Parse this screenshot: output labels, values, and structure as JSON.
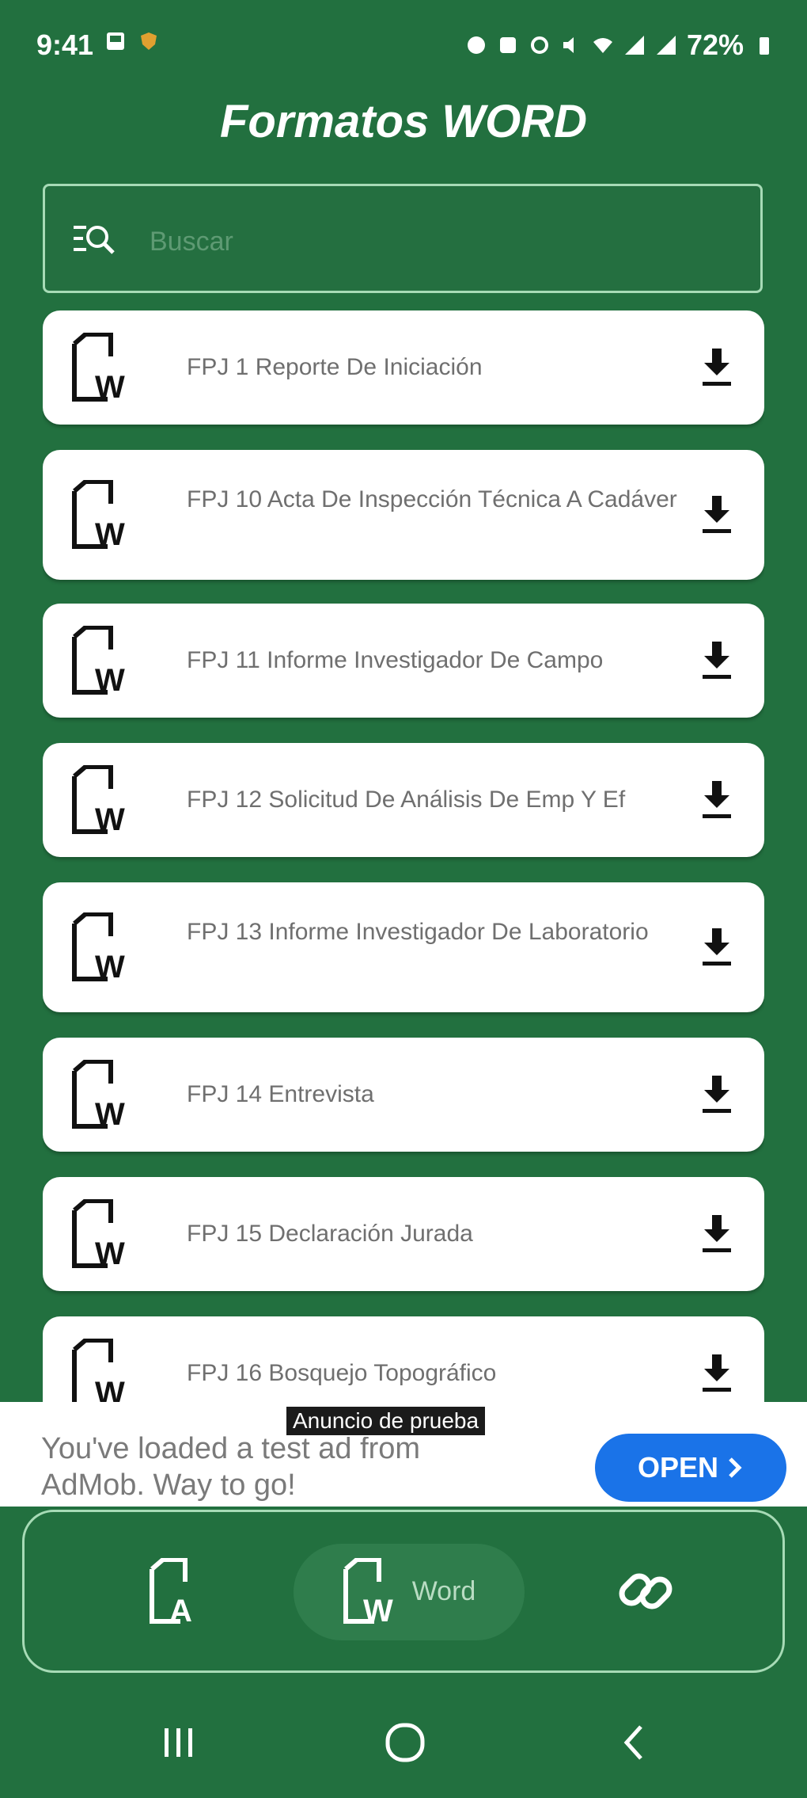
{
  "status_bar": {
    "time": "9:41",
    "battery": "72%"
  },
  "app": {
    "title": "Formatos WORD"
  },
  "search": {
    "placeholder": "Buscar"
  },
  "documents": [
    {
      "title": "FPJ 1 Reporte De Iniciación"
    },
    {
      "title": "FPJ 10 Acta De Inspección Técnica A Cadáver"
    },
    {
      "title": "FPJ 11 Informe Investigador De Campo"
    },
    {
      "title": "FPJ 12 Solicitud De Análisis De Emp Y Ef"
    },
    {
      "title": "FPJ 13 Informe Investigador De Laboratorio"
    },
    {
      "title": "FPJ 14 Entrevista"
    },
    {
      "title": "FPJ 15 Declaración Jurada"
    },
    {
      "title": "FPJ 16 Bosquejo Topográfico"
    }
  ],
  "ad": {
    "label": "Anuncio de prueba",
    "text": "You've loaded a test ad from AdMob. Way to go!",
    "button": "OPEN"
  },
  "bottom_nav": {
    "items": [
      {
        "icon": "pdf-document-icon",
        "label": ""
      },
      {
        "icon": "word-document-icon",
        "label": "Word"
      },
      {
        "icon": "link-icon",
        "label": ""
      }
    ]
  },
  "colors": {
    "background": "#22703f",
    "card": "#ffffff",
    "accent_border": "#a7dbb6",
    "ad_button": "#1a73e8"
  }
}
